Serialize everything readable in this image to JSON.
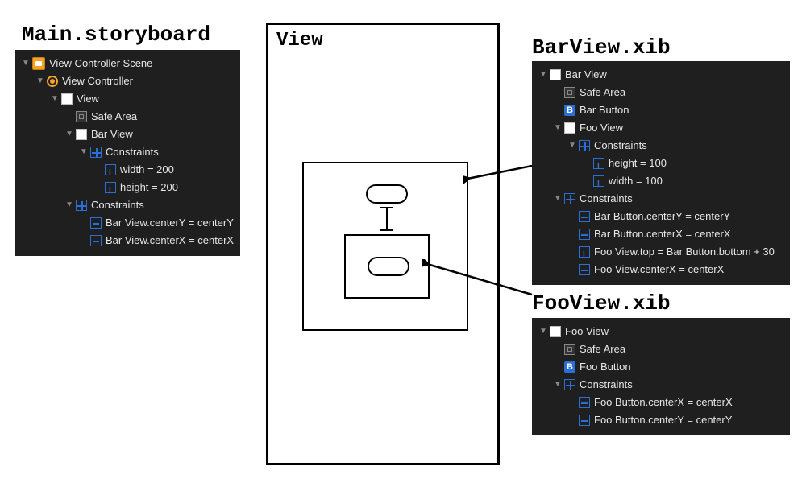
{
  "headers": {
    "main": "Main.storyboard",
    "bar": "BarView.xib",
    "foo": "FooView.xib"
  },
  "device": {
    "title": "View"
  },
  "outlines": {
    "main": [
      {
        "indent": 0,
        "twisty": "open",
        "icon": "scene",
        "label": "View Controller Scene"
      },
      {
        "indent": 1,
        "twisty": "open",
        "icon": "circle",
        "label": "View Controller"
      },
      {
        "indent": 2,
        "twisty": "open",
        "icon": "view",
        "label": "View"
      },
      {
        "indent": 3,
        "twisty": "none",
        "icon": "safearea",
        "label": "Safe Area"
      },
      {
        "indent": 3,
        "twisty": "open",
        "icon": "view",
        "label": "Bar View"
      },
      {
        "indent": 4,
        "twisty": "open",
        "icon": "constraints-group",
        "label": "Constraints"
      },
      {
        "indent": 5,
        "twisty": "none",
        "icon": "constraint",
        "label": "width = 200"
      },
      {
        "indent": 5,
        "twisty": "none",
        "icon": "constraint",
        "label": "height = 200"
      },
      {
        "indent": 3,
        "twisty": "open",
        "icon": "constraints-group",
        "label": "Constraints"
      },
      {
        "indent": 4,
        "twisty": "none",
        "icon": "constraint-alt",
        "label": "Bar View.centerY = centerY"
      },
      {
        "indent": 4,
        "twisty": "none",
        "icon": "constraint-alt",
        "label": "Bar View.centerX = centerX"
      }
    ],
    "bar": [
      {
        "indent": 0,
        "twisty": "open",
        "icon": "view",
        "label": "Bar View"
      },
      {
        "indent": 1,
        "twisty": "none",
        "icon": "safearea",
        "label": "Safe Area"
      },
      {
        "indent": 1,
        "twisty": "none",
        "icon": "button",
        "label": "Bar Button"
      },
      {
        "indent": 1,
        "twisty": "open",
        "icon": "view",
        "label": "Foo View"
      },
      {
        "indent": 2,
        "twisty": "open",
        "icon": "constraints-group",
        "label": "Constraints"
      },
      {
        "indent": 3,
        "twisty": "none",
        "icon": "constraint",
        "label": "height = 100"
      },
      {
        "indent": 3,
        "twisty": "none",
        "icon": "constraint",
        "label": "width = 100"
      },
      {
        "indent": 1,
        "twisty": "open",
        "icon": "constraints-group",
        "label": "Constraints"
      },
      {
        "indent": 2,
        "twisty": "none",
        "icon": "constraint-alt",
        "label": "Bar Button.centerY = centerY"
      },
      {
        "indent": 2,
        "twisty": "none",
        "icon": "constraint-alt",
        "label": "Bar Button.centerX = centerX"
      },
      {
        "indent": 2,
        "twisty": "none",
        "icon": "constraint",
        "label": "Foo View.top = Bar Button.bottom + 30"
      },
      {
        "indent": 2,
        "twisty": "none",
        "icon": "constraint-alt",
        "label": "Foo View.centerX = centerX"
      }
    ],
    "foo": [
      {
        "indent": 0,
        "twisty": "open",
        "icon": "view",
        "label": "Foo View"
      },
      {
        "indent": 1,
        "twisty": "none",
        "icon": "safearea",
        "label": "Safe Area"
      },
      {
        "indent": 1,
        "twisty": "none",
        "icon": "button",
        "label": "Foo Button"
      },
      {
        "indent": 1,
        "twisty": "open",
        "icon": "constraints-group",
        "label": "Constraints"
      },
      {
        "indent": 2,
        "twisty": "none",
        "icon": "constraint-alt",
        "label": "Foo Button.centerX = centerX"
      },
      {
        "indent": 2,
        "twisty": "none",
        "icon": "constraint-alt",
        "label": "Foo Button.centerY = centerY"
      }
    ]
  }
}
